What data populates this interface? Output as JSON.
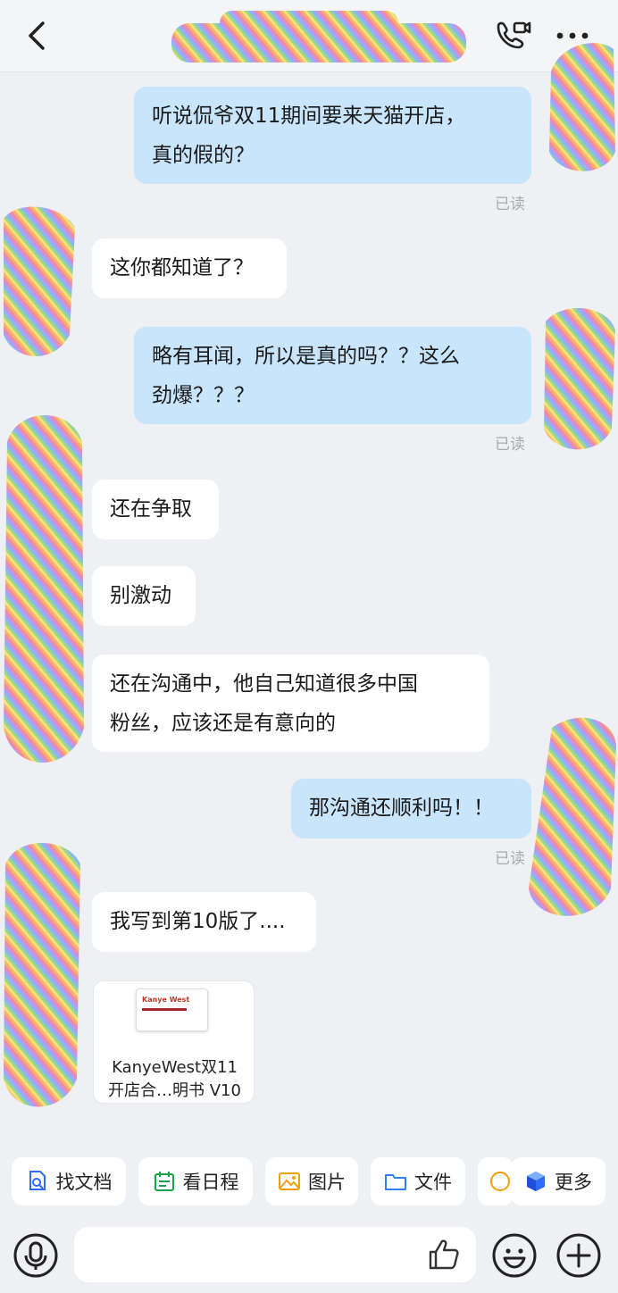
{
  "chat": {
    "messages": [
      {
        "id": "m1",
        "sender": "me",
        "text": "听说侃爷双11期间要来天猫开店，\n真的假的？",
        "status": "已读"
      },
      {
        "id": "m2",
        "sender": "other",
        "text": "这你都知道了？"
      },
      {
        "id": "m3",
        "sender": "me",
        "text": "略有耳闻，所以是真的吗？？这么\n劲爆？？？",
        "status": "已读"
      },
      {
        "id": "m4",
        "sender": "other",
        "text": "还在争取"
      },
      {
        "id": "m5",
        "sender": "other",
        "text": "别激动"
      },
      {
        "id": "m6",
        "sender": "other",
        "text": "还在沟通中，他自己知道很多中国\n粉丝，应该还是有意向的"
      },
      {
        "id": "m7",
        "sender": "me",
        "text": "那沟通还顺利吗！！",
        "status": "已读"
      },
      {
        "id": "m8",
        "sender": "other",
        "text": "我写到第10版了...."
      }
    ],
    "file_card": {
      "thumb_title": "Kanye West",
      "name": "KanyeWest双11\n开店合…明书 V10"
    }
  },
  "quick_actions": [
    {
      "label": "找文档",
      "icon": "doc-search-icon",
      "color": "#2f6bff"
    },
    {
      "label": "看日程",
      "icon": "calendar-icon",
      "color": "#16a34a"
    },
    {
      "label": "图片",
      "icon": "image-icon",
      "color": "#f59e0b"
    },
    {
      "label": "文件",
      "icon": "folder-icon",
      "color": "#2f80ed"
    },
    {
      "label": "",
      "icon": "partial-icon",
      "color": "#f59e0b"
    },
    {
      "label": "更多",
      "icon": "app-cube-icon",
      "color": "#2f6bff"
    }
  ],
  "input": {
    "placeholder": ""
  },
  "colors": {
    "my_bubble": "#c8e5fc",
    "their_bubble": "#ffffff",
    "background": "#eef0f4"
  }
}
